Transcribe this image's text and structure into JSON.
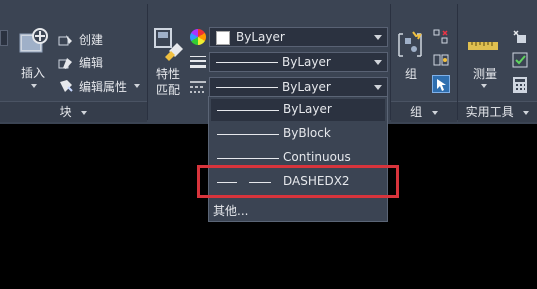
{
  "block_panel": {
    "insert_label": "插入",
    "create_label": "创建",
    "edit_label": "编辑",
    "edit_attr_label": "编辑属性",
    "panel_title": "块"
  },
  "properties_panel": {
    "match_label_1": "特性",
    "match_label_2": "匹配",
    "color_value": "ByLayer",
    "lineweight_value": "ByLayer",
    "linetype_value": "ByLayer"
  },
  "linetype_dropdown": {
    "options": [
      "ByLayer",
      "ByBlock",
      "Continuous",
      "DASHEDX2"
    ],
    "other_label": "其他..."
  },
  "group_panel": {
    "group_label": "组",
    "panel_title": "组"
  },
  "utilities_panel": {
    "measure_label": "测量",
    "panel_title": "实用工具"
  },
  "colors": {
    "ribbon_bg": "#3b4453",
    "highlight_red": "#d8343c"
  }
}
